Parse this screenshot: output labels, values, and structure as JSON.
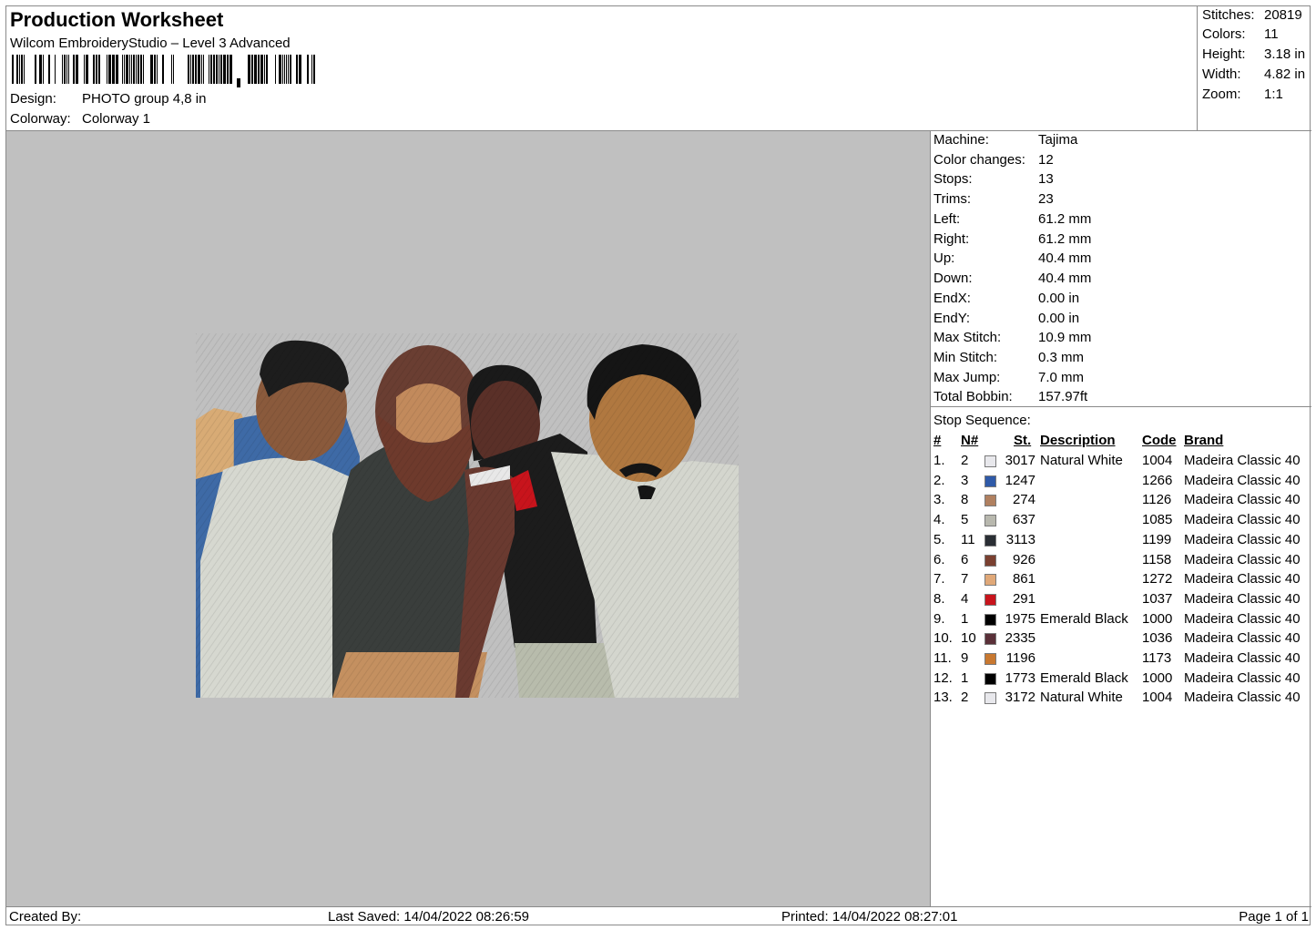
{
  "header": {
    "title": "Production Worksheet",
    "subtitle": "Wilcom EmbroideryStudio – Level 3 Advanced",
    "design_label": "Design:",
    "design_value": "PHOTO group 4,8 in",
    "colorway_label": "Colorway:",
    "colorway_value": "Colorway 1"
  },
  "stats": [
    {
      "label": "Stitches:",
      "value": "20819"
    },
    {
      "label": "Colors:",
      "value": "11"
    },
    {
      "label": "Height:",
      "value": "3.18 in"
    },
    {
      "label": "Width:",
      "value": "4.82 in"
    },
    {
      "label": "Zoom:",
      "value": "1:1"
    }
  ],
  "machine_info": [
    {
      "label": "Machine:",
      "value": "Tajima"
    },
    {
      "label": "Color changes:",
      "value": "12"
    },
    {
      "label": "Stops:",
      "value": "13"
    },
    {
      "label": "Trims:",
      "value": "23"
    },
    {
      "label": "Left:",
      "value": "61.2 mm"
    },
    {
      "label": "Right:",
      "value": "61.2 mm"
    },
    {
      "label": "Up:",
      "value": "40.4 mm"
    },
    {
      "label": "Down:",
      "value": "40.4 mm"
    },
    {
      "label": "EndX:",
      "value": "0.00 in"
    },
    {
      "label": "EndY:",
      "value": "0.00 in"
    },
    {
      "label": "Max Stitch:",
      "value": "10.9 mm"
    },
    {
      "label": "Min Stitch:",
      "value": "0.3 mm"
    },
    {
      "label": "Max Jump:",
      "value": "7.0 mm"
    },
    {
      "label": "Total Bobbin:",
      "value": "157.97ft"
    }
  ],
  "stop_sequence": {
    "title": "Stop Sequence:",
    "headers": {
      "num": "#",
      "n": "N#",
      "st": "St.",
      "desc": "Description",
      "code": "Code",
      "brand": "Brand"
    },
    "rows": [
      {
        "num": "1.",
        "n": "2",
        "color": "#e8e8ec",
        "st": "3017",
        "desc": "Natural White",
        "code": "1004",
        "brand": "Madeira Classic 40"
      },
      {
        "num": "2.",
        "n": "3",
        "color": "#2f5aa8",
        "st": "1247",
        "desc": "",
        "code": "1266",
        "brand": "Madeira Classic 40"
      },
      {
        "num": "3.",
        "n": "8",
        "color": "#b08060",
        "st": "274",
        "desc": "",
        "code": "1126",
        "brand": "Madeira Classic 40"
      },
      {
        "num": "4.",
        "n": "5",
        "color": "#b8b8ae",
        "st": "637",
        "desc": "",
        "code": "1085",
        "brand": "Madeira Classic 40"
      },
      {
        "num": "5.",
        "n": "11",
        "color": "#2a2e34",
        "st": "3113",
        "desc": "",
        "code": "1199",
        "brand": "Madeira Classic 40"
      },
      {
        "num": "6.",
        "n": "6",
        "color": "#7a4030",
        "st": "926",
        "desc": "",
        "code": "1158",
        "brand": "Madeira Classic 40"
      },
      {
        "num": "7.",
        "n": "7",
        "color": "#e0a878",
        "st": "861",
        "desc": "",
        "code": "1272",
        "brand": "Madeira Classic 40"
      },
      {
        "num": "8.",
        "n": "4",
        "color": "#c8141c",
        "st": "291",
        "desc": "",
        "code": "1037",
        "brand": "Madeira Classic 40"
      },
      {
        "num": "9.",
        "n": "1",
        "color": "#000000",
        "st": "1975",
        "desc": "Emerald Black",
        "code": "1000",
        "brand": "Madeira Classic 40"
      },
      {
        "num": "10.",
        "n": "10",
        "color": "#5a3038",
        "st": "2335",
        "desc": "",
        "code": "1036",
        "brand": "Madeira Classic 40"
      },
      {
        "num": "11.",
        "n": "9",
        "color": "#c87830",
        "st": "1196",
        "desc": "",
        "code": "1173",
        "brand": "Madeira Classic 40"
      },
      {
        "num": "12.",
        "n": "1",
        "color": "#000000",
        "st": "1773",
        "desc": "Emerald Black",
        "code": "1000",
        "brand": "Madeira Classic 40"
      },
      {
        "num": "13.",
        "n": "2",
        "color": "#e8e8ec",
        "st": "3172",
        "desc": "Natural White",
        "code": "1004",
        "brand": "Madeira Classic 40"
      }
    ]
  },
  "footer": {
    "created_by": "Created By:",
    "last_saved": "Last Saved: 14/04/2022 08:26:59",
    "printed": "Printed: 14/04/2022 08:27:01",
    "page": "Page 1 of 1"
  }
}
